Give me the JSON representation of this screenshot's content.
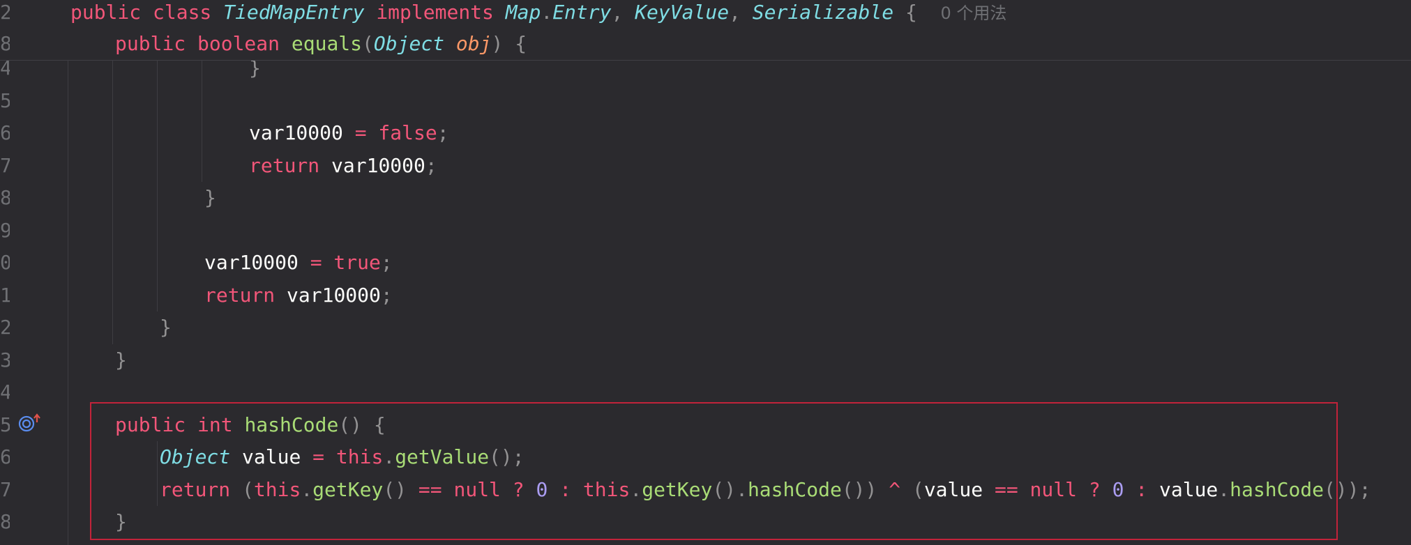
{
  "sticky_header": [
    {
      "num": "2",
      "tokens": [
        {
          "c": "kw",
          "t": "public class "
        },
        {
          "c": "cls",
          "t": "TiedMapEntry "
        },
        {
          "c": "kw",
          "t": "implements "
        },
        {
          "c": "cls",
          "t": "Map"
        },
        {
          "c": "pun",
          "t": "."
        },
        {
          "c": "cls",
          "t": "Entry"
        },
        {
          "c": "pun",
          "t": ", "
        },
        {
          "c": "cls",
          "t": "KeyValue"
        },
        {
          "c": "pun",
          "t": ", "
        },
        {
          "c": "cls",
          "t": "Serializable "
        },
        {
          "c": "pun",
          "t": "{  "
        },
        {
          "c": "hint",
          "t": "0 个用法"
        }
      ]
    },
    {
      "num": "8",
      "tokens": [
        {
          "c": "kw",
          "t": "public boolean "
        },
        {
          "c": "fn",
          "t": "equals"
        },
        {
          "c": "pun",
          "t": "("
        },
        {
          "c": "cls",
          "t": "Object "
        },
        {
          "c": "par",
          "t": "obj"
        },
        {
          "c": "pun",
          "t": ") {"
        }
      ]
    }
  ],
  "lines": [
    {
      "num": "4",
      "indent": 4,
      "tokens": [
        {
          "c": "pun",
          "t": "}"
        }
      ]
    },
    {
      "num": "5",
      "indent": 0,
      "tokens": []
    },
    {
      "num": "6",
      "indent": 4,
      "tokens": [
        {
          "c": "txt",
          "t": "var10000 "
        },
        {
          "c": "kw",
          "t": "= false"
        },
        {
          "c": "pun",
          "t": ";"
        }
      ]
    },
    {
      "num": "7",
      "indent": 4,
      "tokens": [
        {
          "c": "kw",
          "t": "return "
        },
        {
          "c": "txt",
          "t": "var10000"
        },
        {
          "c": "pun",
          "t": ";"
        }
      ]
    },
    {
      "num": "8",
      "indent": 3,
      "tokens": [
        {
          "c": "pun",
          "t": "}"
        }
      ]
    },
    {
      "num": "9",
      "indent": 0,
      "tokens": []
    },
    {
      "num": "0",
      "indent": 3,
      "tokens": [
        {
          "c": "txt",
          "t": "var10000 "
        },
        {
          "c": "kw",
          "t": "= true"
        },
        {
          "c": "pun",
          "t": ";"
        }
      ]
    },
    {
      "num": "1",
      "indent": 3,
      "tokens": [
        {
          "c": "kw",
          "t": "return "
        },
        {
          "c": "txt",
          "t": "var10000"
        },
        {
          "c": "pun",
          "t": ";"
        }
      ]
    },
    {
      "num": "2",
      "indent": 2,
      "tokens": [
        {
          "c": "pun",
          "t": "}"
        }
      ]
    },
    {
      "num": "3",
      "indent": 1,
      "tokens": [
        {
          "c": "pun",
          "t": "}"
        }
      ]
    },
    {
      "num": "4",
      "indent": 0,
      "tokens": []
    },
    {
      "num": "5",
      "indent": 1,
      "tokens": [
        {
          "c": "kw",
          "t": "public int "
        },
        {
          "c": "fn",
          "t": "hashCode"
        },
        {
          "c": "pun",
          "t": "() {"
        }
      ]
    },
    {
      "num": "6",
      "indent": 2,
      "tokens": [
        {
          "c": "cls",
          "t": "Object "
        },
        {
          "c": "txt",
          "t": "value "
        },
        {
          "c": "kw",
          "t": "= this"
        },
        {
          "c": "pun",
          "t": "."
        },
        {
          "c": "fn",
          "t": "getValue"
        },
        {
          "c": "pun",
          "t": "();"
        }
      ]
    },
    {
      "num": "7",
      "indent": 2,
      "tokens": [
        {
          "c": "kw",
          "t": "return "
        },
        {
          "c": "pun",
          "t": "("
        },
        {
          "c": "kw",
          "t": "this"
        },
        {
          "c": "pun",
          "t": "."
        },
        {
          "c": "fn",
          "t": "getKey"
        },
        {
          "c": "pun",
          "t": "() "
        },
        {
          "c": "kw",
          "t": "== null ? "
        },
        {
          "c": "num",
          "t": "0"
        },
        {
          "c": "kw",
          "t": " : this"
        },
        {
          "c": "pun",
          "t": "."
        },
        {
          "c": "fn",
          "t": "getKey"
        },
        {
          "c": "pun",
          "t": "()."
        },
        {
          "c": "fn",
          "t": "hashCode"
        },
        {
          "c": "pun",
          "t": "()) "
        },
        {
          "c": "kw",
          "t": "^ "
        },
        {
          "c": "pun",
          "t": "("
        },
        {
          "c": "txt",
          "t": "value "
        },
        {
          "c": "kw",
          "t": "== null ? "
        },
        {
          "c": "num",
          "t": "0"
        },
        {
          "c": "kw",
          "t": " : "
        },
        {
          "c": "txt",
          "t": "value"
        },
        {
          "c": "pun",
          "t": "."
        },
        {
          "c": "fn",
          "t": "hashCode"
        },
        {
          "c": "pun",
          "t": "());"
        }
      ]
    },
    {
      "num": "8",
      "indent": 1,
      "tokens": [
        {
          "c": "pun",
          "t": "}"
        }
      ]
    }
  ],
  "gutter": {
    "icon": "override-method-icon",
    "color": "#5b8def"
  },
  "highlight_color": "#c2233a"
}
